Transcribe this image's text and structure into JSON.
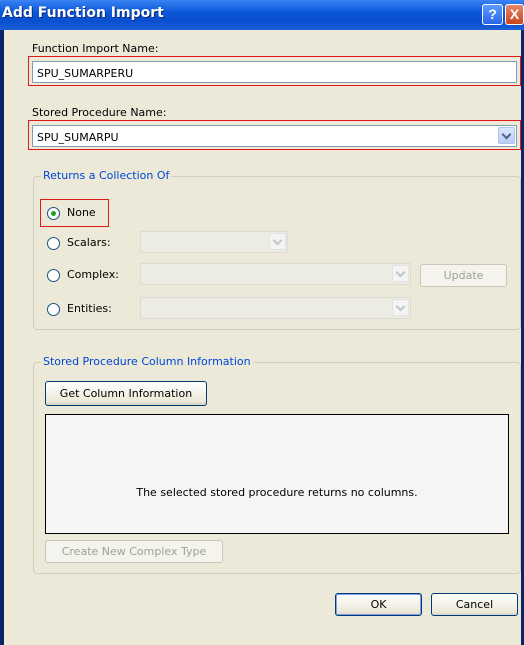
{
  "window": {
    "title": "Add Function Import",
    "help_glyph": "?",
    "close_glyph": "X"
  },
  "function_import": {
    "label": "Function Import Name:",
    "value": "SPU_SUMARPERU"
  },
  "stored_procedure": {
    "label": "Stored Procedure Name:",
    "value": "SPU_SUMARPU"
  },
  "returns": {
    "legend": "Returns a Collection Of",
    "options": [
      {
        "label": "None",
        "selected": true
      },
      {
        "label": "Scalars:",
        "selected": false
      },
      {
        "label": "Complex:",
        "selected": false
      },
      {
        "label": "Entities:",
        "selected": false
      }
    ],
    "update_label": "Update"
  },
  "column_info": {
    "legend": "Stored Procedure Column Information",
    "get_button": "Get Column Information",
    "message": "The selected stored procedure returns no columns.",
    "create_button": "Create New Complex Type"
  },
  "footer": {
    "ok": "OK",
    "cancel": "Cancel"
  },
  "colors": {
    "titlebar": "#0a4fcf",
    "highlight": "#e01818",
    "legend": "#0046d5",
    "dialog_bg": "#ece9d8"
  }
}
